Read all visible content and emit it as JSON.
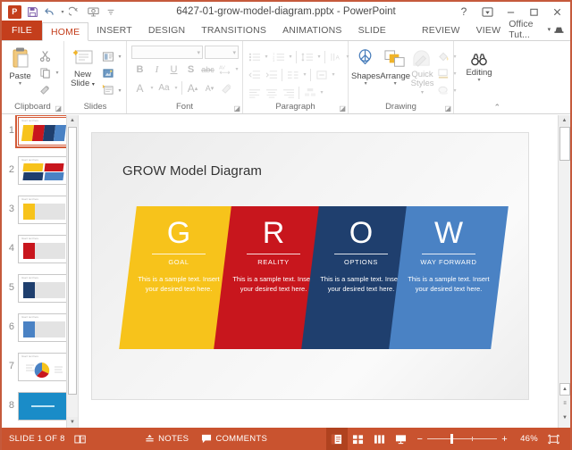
{
  "window": {
    "title": "6427-01-grow-model-diagram.pptx - PowerPoint",
    "app_logo": "P",
    "help_label": "?",
    "ribbon_display_label": "ribbon-display-options-icon",
    "minimize_label": "–",
    "maximize_label": "❐",
    "close_label": "✕"
  },
  "qat": {
    "items": [
      {
        "name": "save-icon",
        "glyph": "save"
      },
      {
        "name": "undo-icon",
        "glyph": "undo"
      },
      {
        "name": "redo-icon",
        "glyph": "redo"
      },
      {
        "name": "start-slideshow-icon",
        "glyph": "slideshow"
      },
      {
        "name": "customize-qat-icon",
        "glyph": "chevron"
      }
    ]
  },
  "tabs": [
    {
      "label": "FILE",
      "id": "file"
    },
    {
      "label": "HOME",
      "id": "home"
    },
    {
      "label": "INSERT",
      "id": "insert"
    },
    {
      "label": "DESIGN",
      "id": "design"
    },
    {
      "label": "TRANSITIONS",
      "id": "transitions"
    },
    {
      "label": "ANIMATIONS",
      "id": "animations"
    },
    {
      "label": "SLIDE SHOW",
      "id": "slide-show"
    },
    {
      "label": "REVIEW",
      "id": "review"
    },
    {
      "label": "VIEW",
      "id": "view"
    }
  ],
  "account": {
    "name": "Office Tut...",
    "dropdown": "▾"
  },
  "ribbon": {
    "groups": [
      {
        "label": "Clipboard",
        "id": "clipboard"
      },
      {
        "label": "Slides",
        "id": "slides"
      },
      {
        "label": "Font",
        "id": "font"
      },
      {
        "label": "Paragraph",
        "id": "paragraph"
      },
      {
        "label": "Drawing",
        "id": "drawing"
      },
      {
        "label": "Editing",
        "id": "editing"
      }
    ],
    "clipboard": {
      "paste_label": "Paste",
      "cut": "cut-icon",
      "copy": "copy-icon",
      "format_painter": "format-painter-icon"
    },
    "slides": {
      "new_slide_label": "New\nSlide",
      "new_slide_line1": "New",
      "new_slide_line2": "Slide",
      "layout": "layout-icon",
      "reset": "reset-icon",
      "section": "section-icon"
    },
    "font": {
      "font_name_value": "",
      "font_size_value": "",
      "bold": "B",
      "italic": "I",
      "underline": "U",
      "shadow": "S",
      "strikethrough": "abc",
      "spacing": "AV",
      "font_color": "A",
      "change_case": "Aa",
      "grow_font": "A",
      "shrink_font": "A",
      "clear_formatting": "clear-formatting-icon"
    },
    "paragraph": {
      "bullets": "bullets-icon",
      "numbering": "numbering-icon",
      "decrease_indent": "decrease-indent-icon",
      "increase_indent": "increase-indent-icon",
      "line_spacing": "line-spacing-icon",
      "text_direction": "text-direction-icon",
      "align_text": "align-text-icon",
      "convert_smartart": "smartart-icon",
      "align_left": "align-left-icon",
      "align_center": "align-center-icon",
      "align_right": "align-right-icon",
      "columns": "columns-icon"
    },
    "drawing": {
      "shapes_label": "Shapes",
      "arrange_label": "Arrange",
      "quick_styles_line1": "Quick",
      "quick_styles_line2": "Styles",
      "shape_fill": "shape-fill-icon",
      "shape_outline": "shape-outline-icon",
      "shape_effects": "shape-effects-icon"
    },
    "editing": {
      "label": "Editing",
      "icon": "binoculars-icon"
    },
    "collapse_label": "⌃"
  },
  "thumbnails": [
    {
      "number": "1",
      "selected": true,
      "kind": "grow-four-panel"
    },
    {
      "number": "2",
      "selected": false,
      "kind": "grow-quad"
    },
    {
      "number": "3",
      "selected": false,
      "kind": "single-yellow"
    },
    {
      "number": "4",
      "selected": false,
      "kind": "single-red"
    },
    {
      "number": "5",
      "selected": false,
      "kind": "single-navy"
    },
    {
      "number": "6",
      "selected": false,
      "kind": "single-blue"
    },
    {
      "number": "7",
      "selected": false,
      "kind": "pie-chart"
    },
    {
      "number": "8",
      "selected": false,
      "kind": "full-blue"
    }
  ],
  "thumbnail_placeholder_text": "Insert text here",
  "slide": {
    "title": "GROW Model Diagram",
    "panels": [
      {
        "letter": "G",
        "label": "GOAL",
        "desc": "This is a sample text. Insert your desired text here.",
        "color": "#F7C31B"
      },
      {
        "letter": "R",
        "label": "REALITY",
        "desc": "This is a sample text. Insert your desired text here.",
        "color": "#C8161D"
      },
      {
        "letter": "O",
        "label": "OPTIONS",
        "desc": "This is a sample text. Insert your desired text here.",
        "color": "#1F3F6E"
      },
      {
        "letter": "W",
        "label": "WAY FORWARD",
        "desc": "This is a sample text. Insert your desired text here.",
        "color": "#4A82C4"
      }
    ]
  },
  "status": {
    "slide_counter": "SLIDE 1 OF 8",
    "language_icon": "language-proofing-icon",
    "notes_label": "NOTES",
    "notes_icon": "notes-icon",
    "comments_label": "COMMENTS",
    "comments_icon": "comments-icon",
    "views": [
      {
        "name": "normal-view",
        "active": true
      },
      {
        "name": "slide-sorter-view",
        "active": false
      },
      {
        "name": "reading-view",
        "active": false
      },
      {
        "name": "slide-show-view",
        "active": false
      }
    ],
    "zoom_out": "−",
    "zoom_in": "+",
    "zoom_level": "46%",
    "fit_slide_icon": "fit-slide-to-window-icon"
  }
}
